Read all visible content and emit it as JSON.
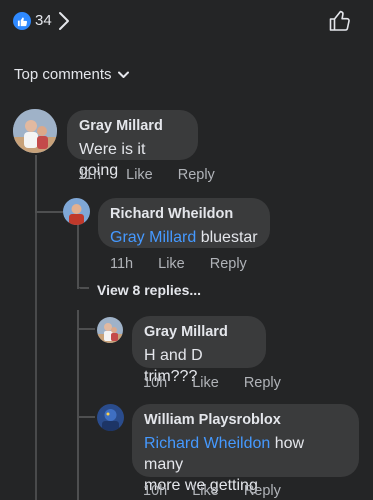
{
  "header": {
    "reaction_count": "34",
    "colors": {
      "like_blue": "#2e89ff",
      "mention": "#4599ff",
      "bg": "#242526",
      "bubble": "#3a3b3c"
    }
  },
  "sort": {
    "label": "Top comments"
  },
  "comments": [
    {
      "author": "Gray Millard",
      "text": "Were is it going",
      "time": "11h",
      "like": "Like",
      "reply": "Reply"
    }
  ],
  "replies": [
    {
      "author": "Richard Wheildon",
      "mention": "Gray Millard",
      "text": "bluestar",
      "time": "11h",
      "like": "Like",
      "reply": "Reply"
    }
  ],
  "view_more": {
    "label": "View 8 replies..."
  },
  "nested": [
    {
      "author": "Gray Millard",
      "text": "H and D trim???",
      "time": "10h",
      "like": "Like",
      "reply": "Reply"
    },
    {
      "author": "William Playsroblox",
      "mention": "Richard Wheildon",
      "text_line1": "how many",
      "text_line2": "more we getting",
      "time": "10h",
      "like": "Like",
      "reply": "Reply"
    }
  ]
}
